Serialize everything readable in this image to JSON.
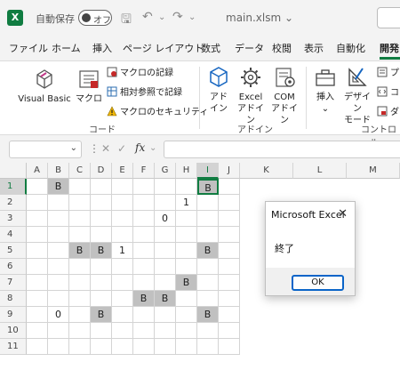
{
  "titlebar": {
    "app_logo": "X",
    "autosave_label": "自動保存",
    "toggle_label": "オフ",
    "filename": "main.xlsm",
    "filename_chevron": "⌄",
    "save_icon_glyph": "🖫",
    "undo_glyph": "↶",
    "redo_glyph": "↷"
  },
  "tabs": [
    "ファイル",
    "ホーム",
    "挿入",
    "ページ レイアウト",
    "数式",
    "データ",
    "校閲",
    "表示",
    "自動化",
    "開発"
  ],
  "ribbon": {
    "code_group": {
      "label": "コード",
      "visual_basic": "Visual Basic",
      "macro": "マクロ",
      "record_macro": "マクロの記録",
      "relative_ref": "相対参照で記録",
      "macro_security": "マクロのセキュリティ"
    },
    "addin_group": {
      "label": "アドイン",
      "addin_line1": "アド",
      "addin_line2": "イン",
      "excel_addin_line1": "Excel",
      "excel_addin_line2": "アドイン",
      "com_addin_line1": "COM",
      "com_addin_line2": "アドイン"
    },
    "controls_group": {
      "label": "コントロール",
      "insert": "挿入",
      "insert_chevron": "⌄",
      "design_mode_line1": "デザイン",
      "design_mode_line2": "モード",
      "side_items": [
        "プ",
        "コ",
        "ダ"
      ]
    }
  },
  "formula_bar": {
    "namebox_value": "",
    "namebox_chevron": "⌄",
    "kebab": "⋮",
    "cancel_glyph": "✕",
    "enter_glyph": "✓",
    "fx_label": "fx",
    "fx_chevron": "⌄",
    "formula_value": ""
  },
  "sheet": {
    "columns": [
      "A",
      "B",
      "C",
      "D",
      "E",
      "F",
      "G",
      "H",
      "I",
      "J",
      "K",
      "L",
      "M"
    ],
    "rows": [
      "1",
      "2",
      "3",
      "4",
      "5",
      "6",
      "7",
      "8",
      "9",
      "10",
      "11"
    ],
    "selected_cell": "I1",
    "cells": {
      "B1": {
        "text": "B",
        "gray": true
      },
      "I1": {
        "text": "B",
        "gray": true
      },
      "H2": {
        "text": "1",
        "gray": false
      },
      "G3": {
        "text": "0",
        "gray": false
      },
      "C5": {
        "text": "B",
        "gray": true
      },
      "D5": {
        "text": "B",
        "gray": true
      },
      "E5": {
        "text": "1",
        "gray": false
      },
      "I5": {
        "text": "B",
        "gray": true
      },
      "H7": {
        "text": "B",
        "gray": true
      },
      "F8": {
        "text": "B",
        "gray": true
      },
      "G8": {
        "text": "B",
        "gray": true
      },
      "B9": {
        "text": "0",
        "gray": false
      },
      "D9": {
        "text": "B",
        "gray": true
      },
      "I9": {
        "text": "B",
        "gray": true
      }
    }
  },
  "dialog": {
    "title": "Microsoft Excel",
    "close_glyph": "✕",
    "message": "終了",
    "ok_label": "OK"
  },
  "colors": {
    "accent": "#107c41",
    "gray_cell": "#c0c0c0",
    "ok_border": "#0a64c8"
  }
}
